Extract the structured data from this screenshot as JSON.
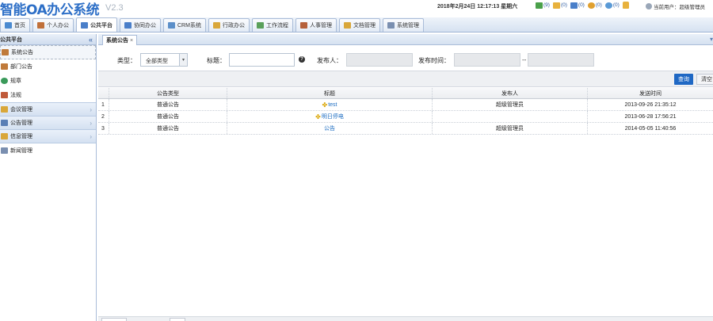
{
  "header": {
    "title": "智能OA办公系统",
    "version": "V2.3",
    "datetime": "2018年2月24日 12:17:13 星期六",
    "notifications": [
      {
        "icon": "users-icon",
        "count": "(9)",
        "color": "#4aa04a"
      },
      {
        "icon": "mail-icon",
        "count": "(0)",
        "color": "#e8b13c"
      },
      {
        "icon": "calendar-icon",
        "count": "(0)",
        "color": "#4a7fc9"
      },
      {
        "icon": "message-icon",
        "count": "(0)",
        "color": "#e0a030"
      },
      {
        "icon": "chat-icon",
        "count": "(0)",
        "color": "#5a9ad6"
      }
    ],
    "lock_icon": "lock-icon",
    "user_label": "当前用户：超级管理员"
  },
  "nav": {
    "tabs": [
      {
        "label": "首页",
        "icon": "home-icon",
        "color": "#4a8ad0"
      },
      {
        "label": "个人办公",
        "icon": "person-icon",
        "color": "#c0703a"
      },
      {
        "label": "公共平台",
        "icon": "platform-icon",
        "color": "#4a7fc9",
        "active": true
      },
      {
        "label": "协同办公",
        "icon": "team-icon",
        "color": "#4a7fc9"
      },
      {
        "label": "CRM系统",
        "icon": "crm-icon",
        "color": "#5b8fc9"
      },
      {
        "label": "行政办公",
        "icon": "folder-icon",
        "color": "#d9a73a"
      },
      {
        "label": "工作流程",
        "icon": "workflow-icon",
        "color": "#5aa05a"
      },
      {
        "label": "人事管理",
        "icon": "hr-icon",
        "color": "#b5603a"
      },
      {
        "label": "文档管理",
        "icon": "document-icon",
        "color": "#d9a73a"
      },
      {
        "label": "系统管理",
        "icon": "settings-icon",
        "color": "#7a8fb0"
      }
    ]
  },
  "sidebar": {
    "title": "公共平台",
    "items": [
      {
        "label": "系统公告",
        "icon": "announcement-icon",
        "color": "#c07a3a",
        "selected": true
      },
      {
        "label": "部门公告",
        "icon": "announcement-icon",
        "color": "#c07a3a"
      },
      {
        "label": "规章",
        "icon": "rules-icon",
        "color": "#3a9a5a"
      },
      {
        "label": "法规",
        "icon": "law-icon",
        "color": "#c05a3a"
      }
    ],
    "groups": [
      {
        "label": "会议管理",
        "icon": "meeting-icon",
        "color": "#d9a73a"
      },
      {
        "label": "公告管理",
        "icon": "notice-icon",
        "color": "#5a7fb5"
      },
      {
        "label": "信息管理",
        "icon": "info-icon",
        "color": "#d9a73a"
      }
    ],
    "last_item": {
      "label": "新闻管理",
      "icon": "news-icon",
      "color": "#7a8fb0"
    }
  },
  "content": {
    "tab_label": "系统公告",
    "tab_close": "×",
    "filter": {
      "type_label": "类型：",
      "type_value": "全部类型",
      "title_label": "标题：",
      "title_value": "",
      "publisher_label": "发布人：",
      "publisher_value": "",
      "time_label": "发布时间：",
      "time_from": "",
      "time_sep": "--",
      "time_to": ""
    },
    "buttons": {
      "query": "查询",
      "clear": "清空"
    },
    "table": {
      "headers": [
        "",
        "公告类型",
        "标题",
        "发布人",
        "发送时间"
      ],
      "rows": [
        {
          "index": "1",
          "type": "普通公告",
          "title": "test",
          "publisher": "超级管理员",
          "time": "2013-09-26 21:35:12"
        },
        {
          "index": "2",
          "type": "普通公告",
          "title": "明日停电",
          "publisher": "",
          "time": "2013-06-28 17:56:21"
        },
        {
          "index": "3",
          "type": "普通公告",
          "title": "公告",
          "publisher": "超级管理员",
          "time": "2014-05-05 11:40:56"
        }
      ]
    }
  }
}
